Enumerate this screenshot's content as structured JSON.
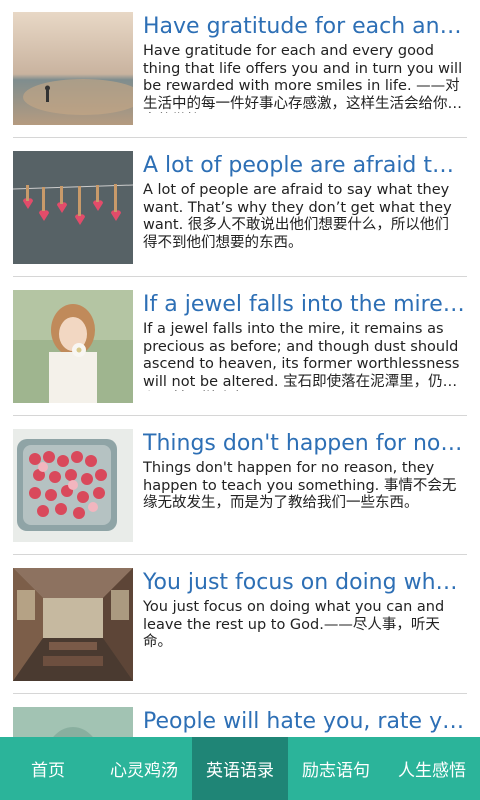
{
  "articles": [
    {
      "title": "Have gratitude for each and every good thing that life offers you",
      "description": "Have gratitude for each and every good thing that life offers you and in turn you will be rewarded with more smiles in life. ——对生活中的每一件好事心存感激，这样生活会给你更多的微笑。",
      "thumb": "beach-sunset-image"
    },
    {
      "title": "A lot of people are afraid to say what they want",
      "description": "A lot of people are afraid to say what they want. That’s why they don’t get what they want. 很多人不敢说出他们想要什么，所以他们得不到他们想要的东西。",
      "thumb": "hearts-clothespins-image"
    },
    {
      "title": "If a jewel falls into the mire, it remains as precious as before",
      "description": "If a jewel falls into the mire, it remains as precious as before; and though dust should ascend to heaven, its former worthlessness will not be altered. 宝石即使落在泥潭里，仍然和以前一样珍贵。",
      "thumb": "girl-with-flower-image"
    },
    {
      "title": "Things don't happen for no reason",
      "description": "Things don't happen for no reason, they happen to teach you something. 事情不会无缘无故发生，而是为了教给我们一些东西。",
      "thumb": "candy-hearts-tin-image"
    },
    {
      "title": "You just focus on doing what you can",
      "description": "You just focus on doing what you can and leave the rest up to God.——尽人事，听天命。",
      "thumb": "train-interior-image"
    },
    {
      "title": "People will hate you, rate you, shake you",
      "description": "",
      "thumb": "teal-portrait-image"
    }
  ],
  "tabs": [
    {
      "label": "首页"
    },
    {
      "label": "心灵鸡汤"
    },
    {
      "label": "英语语录"
    },
    {
      "label": "励志语句"
    },
    {
      "label": "人生感悟"
    }
  ],
  "active_tab": "英语语录",
  "colors": {
    "accent": "#2bb49a",
    "active_tab": "#1f8576",
    "title": "#2d6fb5"
  }
}
